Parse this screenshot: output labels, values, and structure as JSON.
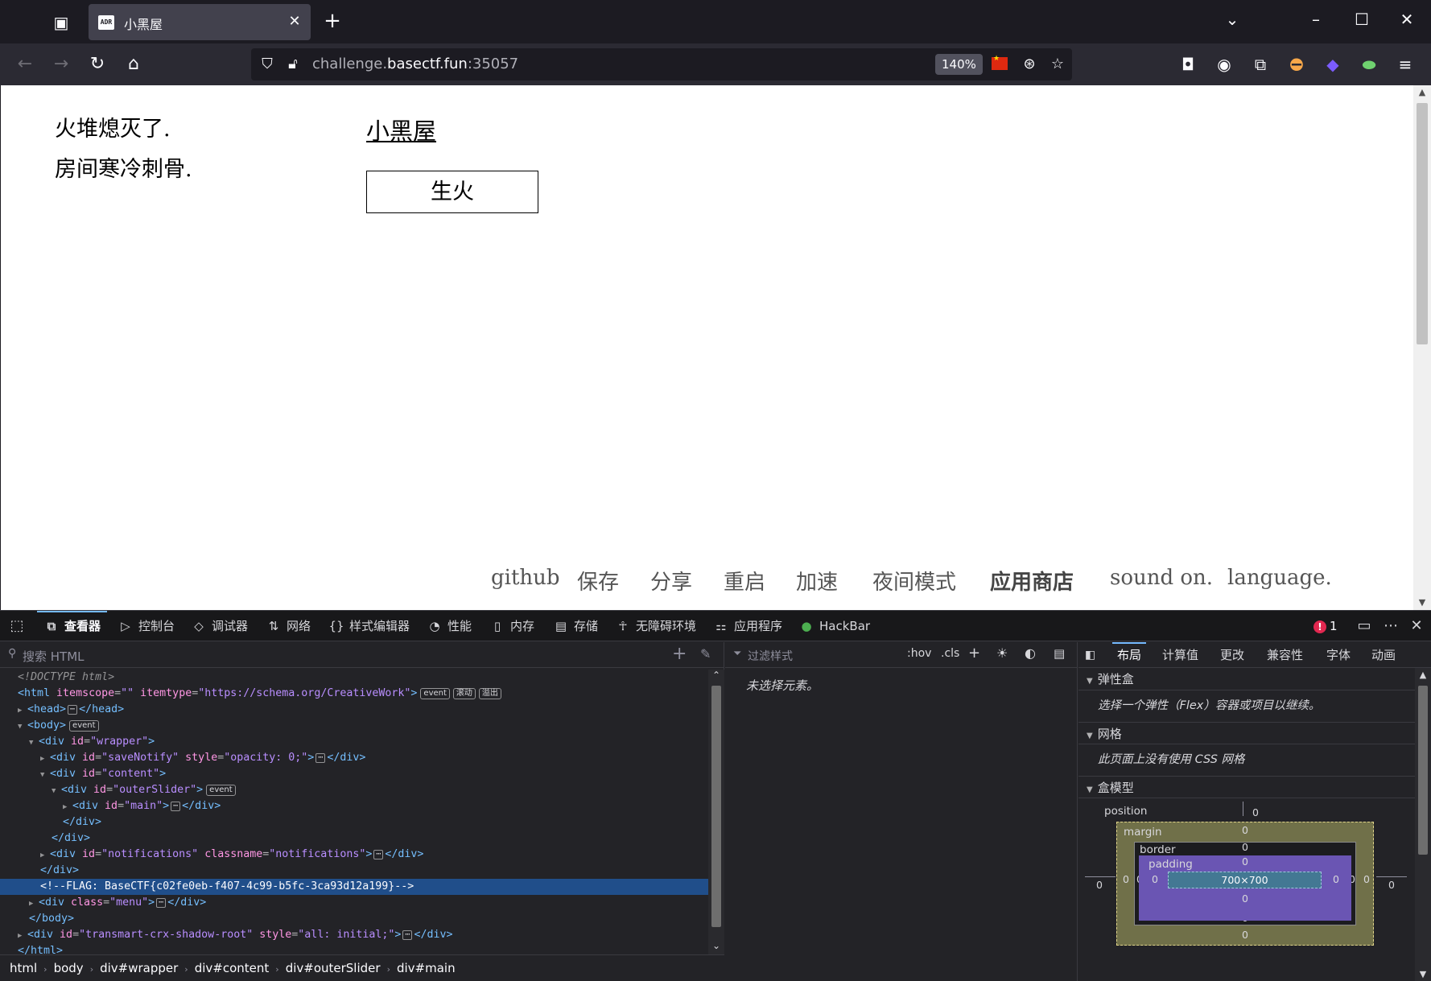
{
  "browser": {
    "tab": {
      "favicon_text": "ADR",
      "title": "小黑屋"
    },
    "url": {
      "prefix": "challenge.",
      "domain": "basectf.fun",
      "port": ":35057"
    },
    "zoom": "140%"
  },
  "page": {
    "status_lines": [
      "火堆熄灭了.",
      "房间寒冷刺骨."
    ],
    "location_title": "小黑屋",
    "fire_button": "生火",
    "menu": [
      {
        "label": "github",
        "bold": false
      },
      {
        "label": "保存",
        "bold": false
      },
      {
        "label": "分享",
        "bold": false
      },
      {
        "label": "重启",
        "bold": false
      },
      {
        "label": "加速",
        "bold": false
      },
      {
        "label": "夜间模式",
        "bold": false
      },
      {
        "label": "应用商店",
        "bold": true
      },
      {
        "label": "sound on.",
        "bold": false
      },
      {
        "label": "language.",
        "bold": false
      }
    ]
  },
  "devtools": {
    "tabs": [
      {
        "label": "查看器",
        "icon": "inspector-icon",
        "glyph": "⧉",
        "active": true
      },
      {
        "label": "控制台",
        "icon": "console-icon",
        "glyph": "▷",
        "active": false
      },
      {
        "label": "调试器",
        "icon": "debugger-icon",
        "glyph": "◇",
        "active": false
      },
      {
        "label": "网络",
        "icon": "network-icon",
        "glyph": "⇅",
        "active": false
      },
      {
        "label": "样式编辑器",
        "icon": "style-editor-icon",
        "glyph": "{}",
        "active": false
      },
      {
        "label": "性能",
        "icon": "performance-icon",
        "glyph": "◔",
        "active": false
      },
      {
        "label": "内存",
        "icon": "memory-icon",
        "glyph": "▯",
        "active": false
      },
      {
        "label": "存储",
        "icon": "storage-icon",
        "glyph": "▤",
        "active": false
      },
      {
        "label": "无障碍环境",
        "icon": "accessibility-icon",
        "glyph": "☥",
        "active": false
      },
      {
        "label": "应用程序",
        "icon": "application-icon",
        "glyph": "⚏",
        "active": false
      },
      {
        "label": "HackBar",
        "icon": "hackbar-icon",
        "glyph": "●",
        "active": false
      }
    ],
    "error_count": "1",
    "search_placeholder": "搜索 HTML",
    "tree": {
      "doctype": "<!DOCTYPE html>",
      "html_itemscope": "\"\"",
      "html_itemtype": "\"https://schema.org/CreativeWork\"",
      "badge_event": "event",
      "badge_scroll": "滚动",
      "badge_overflow": "溢出",
      "wrapper_id": "\"wrapper\"",
      "savenotify_id": "\"saveNotify\"",
      "savenotify_style": "\"opacity: 0;\"",
      "content_id": "\"content\"",
      "outerslider_id": "\"outerSlider\"",
      "main_id": "\"main\"",
      "notifications_id": "\"notifications\"",
      "notifications_classname": "\"notifications\"",
      "flag_comment": "<!--FLAG: BaseCTF{c02fe0eb-f407-4c99-b5fc-3ca93d12a199}-->",
      "menu_class": "\"menu\"",
      "transmart_id": "\"transmart-crx-shadow-root\"",
      "transmart_style": "\"all: initial;\""
    },
    "breadcrumbs": [
      "html",
      "body",
      "div#wrapper",
      "div#content",
      "div#outerSlider",
      "div#main"
    ],
    "rules": {
      "filter_placeholder": "过滤样式",
      "hov": ":hov",
      "cls": ".cls",
      "empty_message": "未选择元素。"
    },
    "layout": {
      "tabs": [
        "布局",
        "计算值",
        "更改",
        "兼容性",
        "字体",
        "动画"
      ],
      "flex_title": "弹性盒",
      "flex_note": "选择一个弹性（Flex）容器或项目以继续。",
      "grid_title": "网格",
      "grid_note": "此页面上没有使用 CSS 网格",
      "boxmodel_title": "盒模型",
      "boxmodel": {
        "position_label": "position",
        "margin_label": "margin",
        "border_label": "border",
        "padding_label": "padding",
        "content_size": "700×700",
        "zero": "0"
      }
    }
  }
}
